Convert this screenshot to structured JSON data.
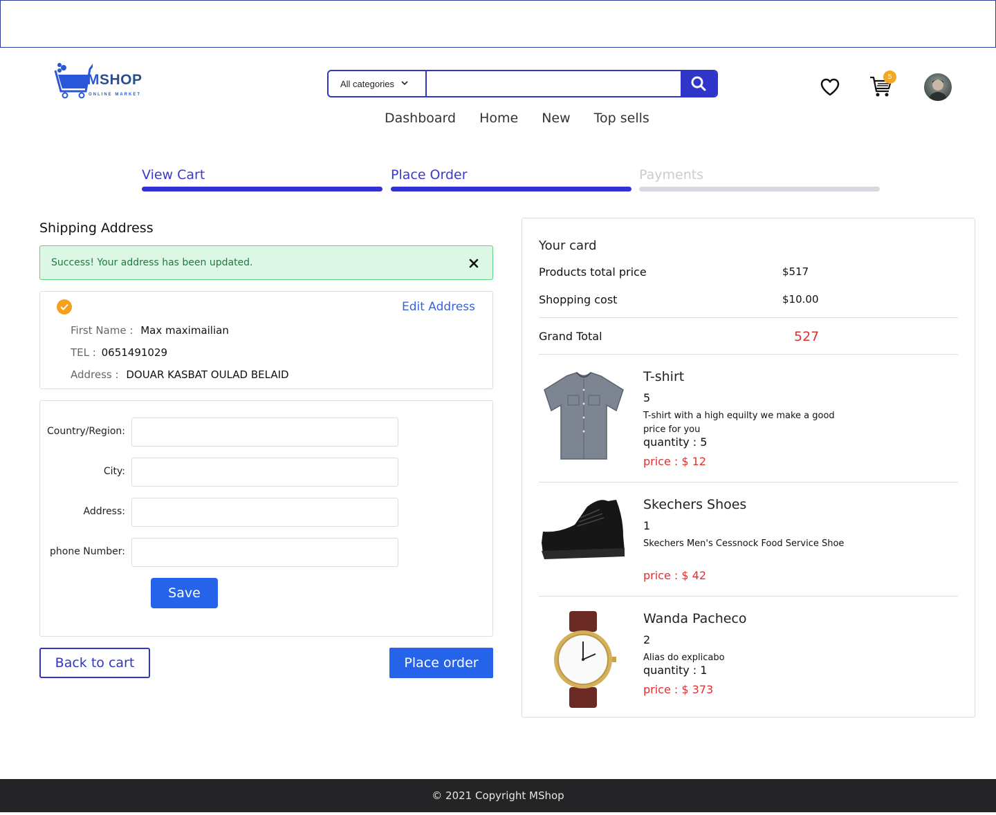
{
  "brand": {
    "name_m": "M",
    "name_rest": "SHOP",
    "tagline": "ONLINE MARKET"
  },
  "search": {
    "category": "All categories",
    "placeholder": ""
  },
  "header": {
    "cart_count": "5"
  },
  "nav": [
    "Dashboard",
    "Home",
    "New",
    "Top sells"
  ],
  "steps": [
    {
      "label": "View Cart",
      "state": "active"
    },
    {
      "label": "Place Order",
      "state": "active"
    },
    {
      "label": "Payments",
      "state": "inactive"
    }
  ],
  "shipping": {
    "title": "Shipping Address",
    "alert": "Success! Your address has been updated.",
    "edit_label": "Edit Address",
    "first_name_label": "First Name :",
    "first_name": "Max maximailian",
    "tel_label": "TEL :",
    "tel": "0651491029",
    "address_label": "Address :",
    "address": "DOUAR KASBAT OULAD BELAID"
  },
  "form": {
    "country_label": "Country/Region:",
    "city_label": "City:",
    "address_label": "Address:",
    "phone_label": "phone Number:",
    "save_label": "Save"
  },
  "actions": {
    "back_label": "Back to cart",
    "place_label": "Place order"
  },
  "summary": {
    "title": "Your card",
    "products_total_label": "Products total price",
    "products_total": "$517",
    "shipping_label": "Shopping cost",
    "shipping": "$10.00",
    "grand_label": "Grand Total",
    "grand": "527"
  },
  "items": [
    {
      "name": "T-shirt",
      "num": "5",
      "desc": "T-shirt with a high equilty we make a good price for you",
      "qty": "quantity : 5",
      "price": "price : $ 12"
    },
    {
      "name": "Skechers Shoes",
      "num": "1",
      "desc": "Skechers Men's Cessnock Food Service Shoe",
      "qty": "",
      "price": "price : $ 42"
    },
    {
      "name": "Wanda Pacheco",
      "num": "2",
      "desc": "Alias do explicabo",
      "qty": "quantity : 1",
      "price": "price : $ 373"
    }
  ],
  "footer": {
    "text": "© 2021 Copyright MShop"
  },
  "colors": {
    "accent": "#2f35c8",
    "button": "#2563eb",
    "price": "#e03030",
    "badge": "#f5a623"
  }
}
